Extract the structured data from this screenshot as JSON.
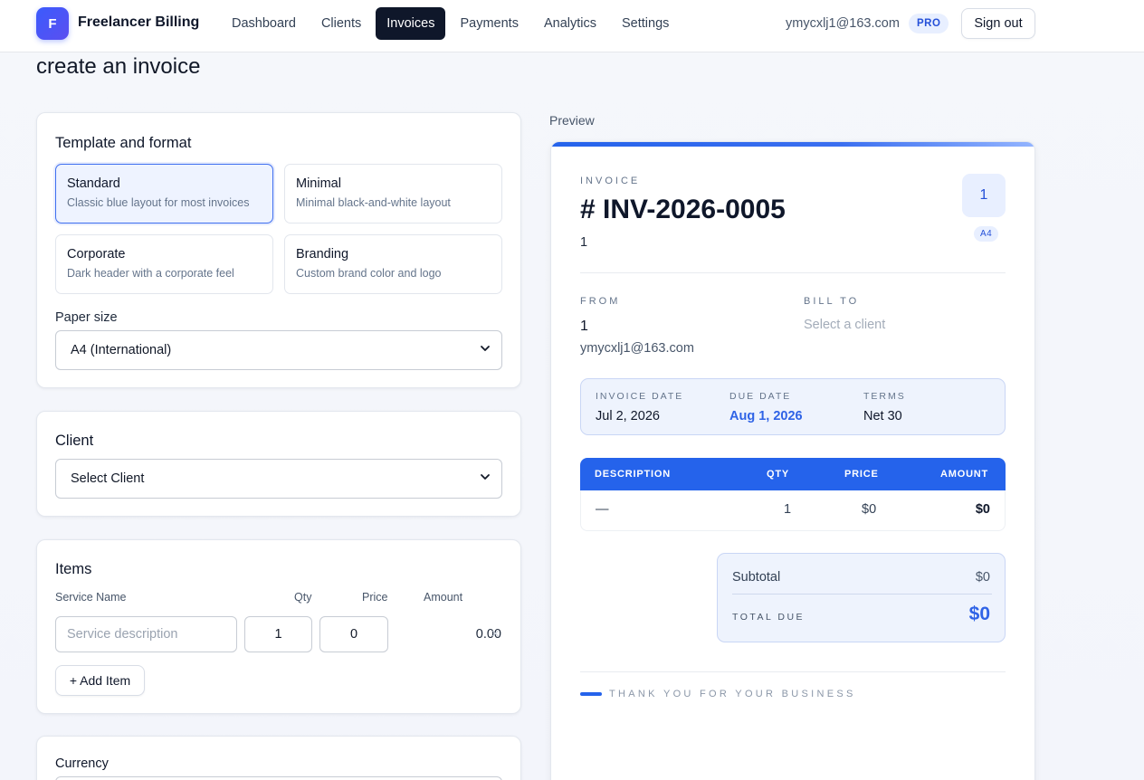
{
  "app": {
    "logo_letter": "F",
    "name": "Freelancer Billing"
  },
  "nav": {
    "items": [
      "Dashboard",
      "Clients",
      "Invoices",
      "Payments",
      "Analytics",
      "Settings"
    ],
    "active": "Invoices"
  },
  "user": {
    "email": "ymycxlj1@163.com",
    "plan_badge": "PRO",
    "signout_label": "Sign out"
  },
  "page": {
    "title": "create an invoice"
  },
  "template_card": {
    "title": "Template and format",
    "options": [
      {
        "name": "Standard",
        "desc": "Classic blue layout for most invoices",
        "selected": true
      },
      {
        "name": "Minimal",
        "desc": "Minimal black-and-white layout",
        "selected": false
      },
      {
        "name": "Corporate",
        "desc": "Dark header with a corporate feel",
        "selected": false
      },
      {
        "name": "Branding",
        "desc": "Custom brand color and logo",
        "selected": false
      }
    ],
    "paper_label": "Paper size",
    "paper_value": "A4 (International)"
  },
  "client_card": {
    "title": "Client",
    "select_value": "Select Client"
  },
  "items_card": {
    "title": "Items",
    "columns": {
      "service": "Service Name",
      "qty": "Qty",
      "price": "Price",
      "amount": "Amount"
    },
    "rows": [
      {
        "service_placeholder": "Service description",
        "qty": "1",
        "price": "0",
        "amount": "0.00"
      }
    ],
    "remove_glyph": "×",
    "add_label": "+ Add Item"
  },
  "currency_card": {
    "title": "Currency"
  },
  "preview": {
    "label": "Preview",
    "invoice_caption": "INVOICE",
    "invoice_number": "# INV-2026-0005",
    "invoice_sub": "1",
    "logo_initial": "1",
    "paper_badge": "A4",
    "from": {
      "caption": "FROM",
      "name": "1",
      "email": "ymycxlj1@163.com"
    },
    "bill_to": {
      "caption": "BILL TO",
      "placeholder": "Select a client"
    },
    "dates": {
      "invoice_date_label": "INVOICE DATE",
      "invoice_date": "Jul 2, 2026",
      "due_date_label": "DUE DATE",
      "due_date": "Aug 1, 2026",
      "terms_label": "TERMS",
      "terms": "Net 30"
    },
    "table": {
      "headers": {
        "description": "DESCRIPTION",
        "qty": "QTY",
        "price": "PRICE",
        "amount": "AMOUNT"
      },
      "rows": [
        {
          "description": "—",
          "qty": "1",
          "price": "$0",
          "amount": "$0"
        }
      ]
    },
    "totals": {
      "subtotal_label": "Subtotal",
      "subtotal": "$0",
      "total_label": "TOTAL DUE",
      "total": "$0"
    },
    "footer": "THANK YOU FOR YOUR BUSINESS"
  },
  "colors": {
    "accent": "#2563eb",
    "nav_active_bg": "#0f172a",
    "selected_border": "#3f6ff0"
  }
}
